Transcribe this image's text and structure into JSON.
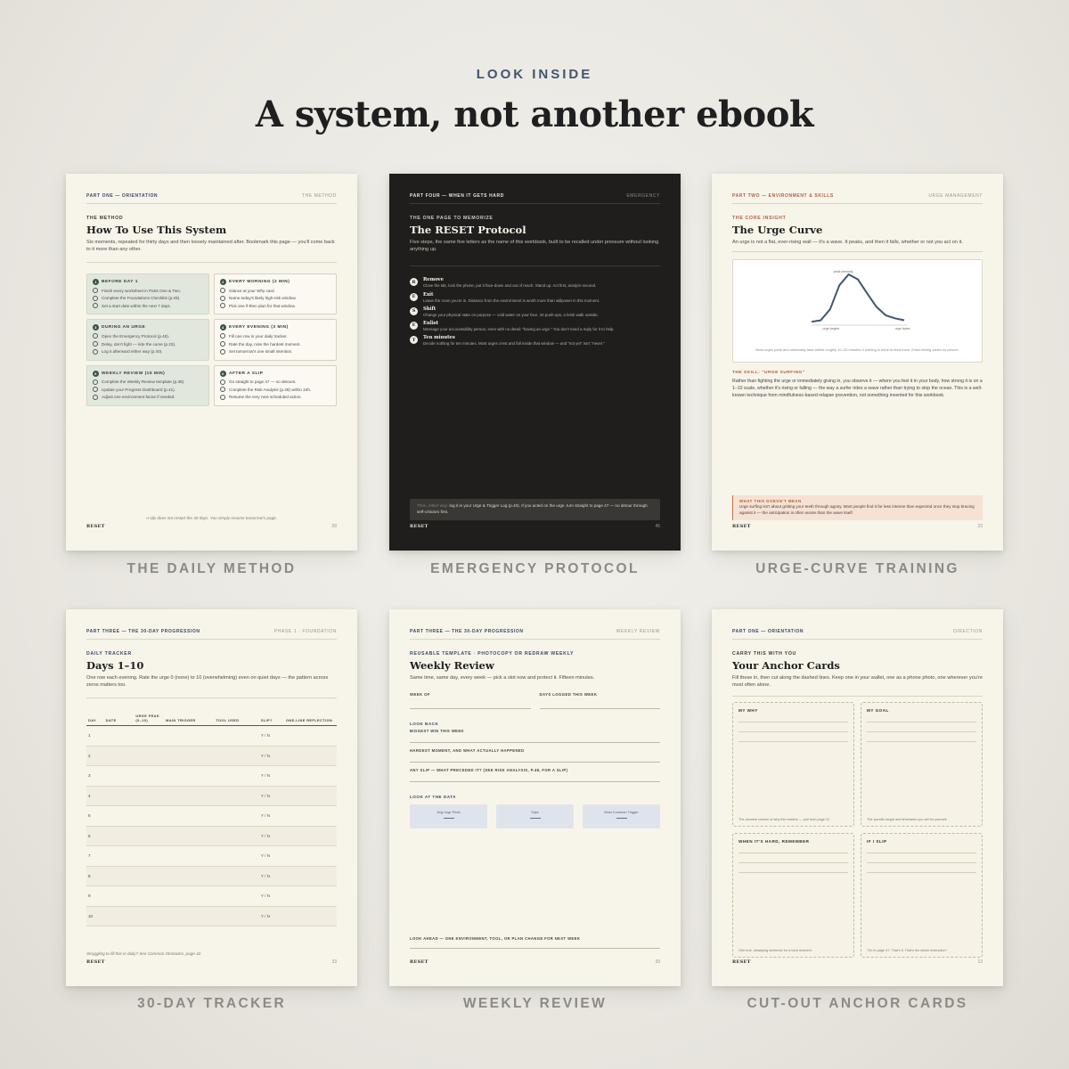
{
  "eyebrow": "LOOK INSIDE",
  "headline": "A system, not another ebook",
  "captions": [
    "THE DAILY METHOD",
    "EMERGENCY PROTOCOL",
    "URGE-CURVE TRAINING",
    "30-DAY TRACKER",
    "WEEKLY REVIEW",
    "CUT-OUT ANCHOR CARDS"
  ],
  "brand": "RESET",
  "method": {
    "runhead_left": "PART ONE — ORIENTATION",
    "runhead_right": "THE METHOD",
    "kicker": "THE METHOD",
    "title": "How To Use This System",
    "lede": "Six moments, repeated for thirty days and then loosely maintained after. Bookmark this page — you'll come back to it more than any other.",
    "cards": [
      {
        "num": "1",
        "title": "BEFORE DAY 1",
        "items": [
          "Finish every worksheet in Parts One & Two.",
          "Complete the Foundations Checklist (p.29).",
          "Set a start date within the next 7 days."
        ]
      },
      {
        "num": "2",
        "title": "EVERY MORNING (2 MIN)",
        "items": [
          "Glance at your Why card.",
          "Name today's likely high-risk window.",
          "Pick one if-then plan for that window."
        ]
      },
      {
        "num": "3",
        "title": "DURING AN URGE",
        "items": [
          "Open the Emergency Protocol (p.45).",
          "Delay, don't fight — ride the curve (p.23).",
          "Log it afterward either way (p.40)."
        ]
      },
      {
        "num": "4",
        "title": "EVERY EVENING (3 MIN)",
        "items": [
          "Fill one row in your daily tracker.",
          "Rate the day, note the hardest moment.",
          "Set tomorrow's one small intention."
        ]
      },
      {
        "num": "5",
        "title": "WEEKLY REVIEW (15 MIN)",
        "items": [
          "Complete the Weekly Review template (p.39).",
          "Update your Progress Dashboard (p.41).",
          "Adjust one environment factor if needed."
        ]
      },
      {
        "num": "6",
        "title": "AFTER A SLIP",
        "items": [
          "Go straight to page 47 — no detours.",
          "Complete the Risk Analysis (p.48) within 24h.",
          "Resume the very next scheduled action."
        ]
      }
    ],
    "footnote": "A slip does not restart the 30 days. You simply resume tomorrow's page.",
    "page": "09"
  },
  "reset": {
    "runhead_left": "PART FOUR — WHEN IT GETS HARD",
    "runhead_right": "EMERGENCY",
    "kicker": "THE ONE PAGE TO MEMORIZE",
    "title": "The RESET Protocol",
    "lede": "Five steps, the same five letters as the name of this workbook, built to be recalled under pressure without looking anything up.",
    "steps": [
      {
        "letter": "R",
        "name": "Remove",
        "desc": "Close the tab, lock the phone, put it face-down and out of reach. Stand up. Act first, analyze second."
      },
      {
        "letter": "E",
        "name": "Exit",
        "desc": "Leave the room you're in. Distance from the environment is worth more than willpower in this moment."
      },
      {
        "letter": "S",
        "name": "Shift",
        "desc": "Change your physical state on purpose — cold water on your face, 20 push-ups, a brisk walk outside."
      },
      {
        "letter": "E",
        "name": "Enlist",
        "desc": "Message your accountability person, even with no detail: \"having an urge.\" You don't need a reply for it to help."
      },
      {
        "letter": "T",
        "name": "Ten minutes",
        "desc": "Decide nothing for ten minutes. Most urges crest and fall inside that window — and \"not yet\" isn't \"never.\""
      }
    ],
    "callout_hl": "Then, either way:",
    "callout": "log it in your Urge & Trigger Log (p.40). If you acted on the urge, turn straight to page 47 — no detour through self-criticism first.",
    "page": "45"
  },
  "urge": {
    "runhead_left": "PART TWO — ENVIRONMENT & SKILLS",
    "runhead_right": "URGE MANAGEMENT",
    "kicker": "THE CORE INSIGHT",
    "title": "The Urge Curve",
    "lede": "An urge is not a flat, ever-rising wall — it's a wave. It peaks, and then it falls, whether or not you act on it.",
    "chart_caption": "Most urges peak and noticeably fade within roughly 10–20 minutes if nothing is done to feed them. Exact timing varies by person.",
    "skill_head": "THE SKILL: \"URGE SURFING\"",
    "skill_body": "Rather than fighting the urge or immediately giving in, you observe it — where you feel it in your body, how strong it is on a 1–10 scale, whether it's rising or falling — the way a surfer rides a wave rather than trying to stop the ocean. This is a well-known technique from mindfulness-based relapse prevention, not something invented for this workbook.",
    "callout_title": "WHAT THIS DOESN'T MEAN",
    "callout_body": "Urge surfing isn't about gritting your teeth through agony. Most people find it far less intense than expected once they stop bracing against it — the anticipation is often worse than the wave itself.",
    "page": "23"
  },
  "chart_data": {
    "type": "line",
    "title": "",
    "annotations": [
      "peak intensity",
      "urge begins",
      "urge fades"
    ],
    "x": [
      0,
      1,
      2,
      3,
      4,
      5,
      6,
      7,
      8,
      9,
      10
    ],
    "values": [
      5,
      8,
      30,
      78,
      100,
      90,
      62,
      35,
      18,
      12,
      8
    ],
    "ylim": [
      0,
      100
    ],
    "grid": false
  },
  "tracker": {
    "runhead_left": "PART THREE — THE 30-DAY PROGRESSION",
    "runhead_right": "PHASE 1 · FOUNDATION",
    "kicker": "DAILY TRACKER",
    "title": "Days 1–10",
    "lede": "One row each evening. Rate the urge 0 (none) to 10 (overwhelming) even on quiet days — the pattern across zeros matters too.",
    "columns": [
      "DAY",
      "DATE",
      "URGE PEAK (0–10)",
      "MAIN TRIGGER",
      "TOOL USED",
      "SLIP?",
      "ONE-LINE REFLECTION"
    ],
    "rows": [
      "1",
      "2",
      "3",
      "4",
      "5",
      "6",
      "7",
      "8",
      "9",
      "10"
    ],
    "yn": "Y / N",
    "footnote": "Struggling to fill this in daily? See Common Obstacles, page 42.",
    "page": "33"
  },
  "weekly": {
    "runhead_left": "PART THREE — THE 30-DAY PROGRESSION",
    "runhead_right": "WEEKLY REVIEW",
    "kicker": "REUSABLE TEMPLATE · PHOTOCOPY OR REDRAW WEEKLY",
    "title": "Weekly Review",
    "lede": "Same time, same day, every week — pick a slot now and protect it. Fifteen minutes.",
    "field_week": "WEEK OF",
    "field_days": "DAYS LOGGED THIS WEEK",
    "look_back": "LOOK BACK",
    "q1": "BIGGEST WIN THIS WEEK",
    "q2": "HARDEST MOMENT, AND WHAT ACTUALLY HAPPENED",
    "q3": "ANY SLIP — WHAT PRECEDED IT? (SEE RISK ANALYSIS, P.48, FOR A SLIP)",
    "look_data": "LOOK AT THE DATA",
    "stats": [
      "Avg Urge Peak",
      "Slips",
      "Most Common Trigger"
    ],
    "look_ahead": "LOOK AHEAD — ONE ENVIRONMENT, TOOL, OR PLAN CHANGE FOR NEXT WEEK",
    "page": "39"
  },
  "anchor": {
    "runhead_left": "PART ONE — ORIENTATION",
    "runhead_right": "DIRECTION",
    "kicker": "CARRY THIS WITH YOU",
    "title": "Your Anchor Cards",
    "lede": "Fill these in, then cut along the dashed lines. Keep one in your wallet, one as a phone photo, one wherever you're most often alone.",
    "cards": [
      {
        "title": "MY WHY",
        "hint": "The clearest version of why this matters — pull from page 12."
      },
      {
        "title": "MY GOAL",
        "hint": "The specific target and timeframe you set for yourself."
      },
      {
        "title": "WHEN IT'S HARD, REMEMBER",
        "hint": "One true, steadying sentence for a hard moment."
      },
      {
        "title": "IF I SLIP",
        "hint": "\"Go to page 47. That's it. That's the whole instruction.\""
      }
    ],
    "page": "13"
  }
}
